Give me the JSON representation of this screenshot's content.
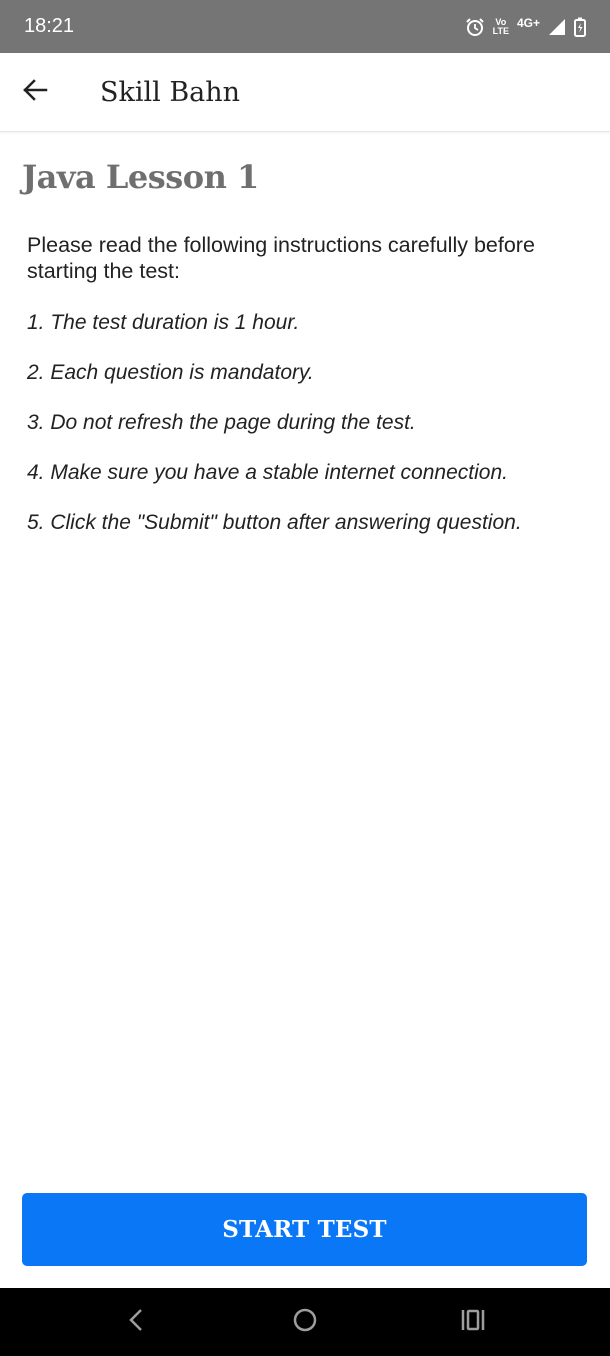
{
  "status_bar": {
    "time": "18:21",
    "icons": [
      "alarm-icon",
      "volte-lte-icon",
      "network-4g-plus-icon",
      "signal-icon",
      "battery-charging-icon"
    ],
    "volte_top": "Vo",
    "volte_bottom": "LTE",
    "network": "4G+"
  },
  "app_bar": {
    "back_icon": "arrow-left-icon",
    "title": "Skill Bahn"
  },
  "lesson": {
    "title": "Java Lesson 1",
    "intro": "Please read the following instructions carefully before starting the test:",
    "rules": [
      "1. The test duration is 1 hour.",
      "2. Each question is mandatory.",
      "3. Do not refresh the page during the test.",
      "4. Make sure you have a stable internet connection.",
      "5. Click the \"Submit\" button after answering question."
    ]
  },
  "actions": {
    "start_label": "START TEST",
    "button_color": "#0a77f7"
  },
  "nav_bar": {
    "icons": [
      "nav-back-icon",
      "nav-home-icon",
      "nav-recents-icon"
    ]
  }
}
